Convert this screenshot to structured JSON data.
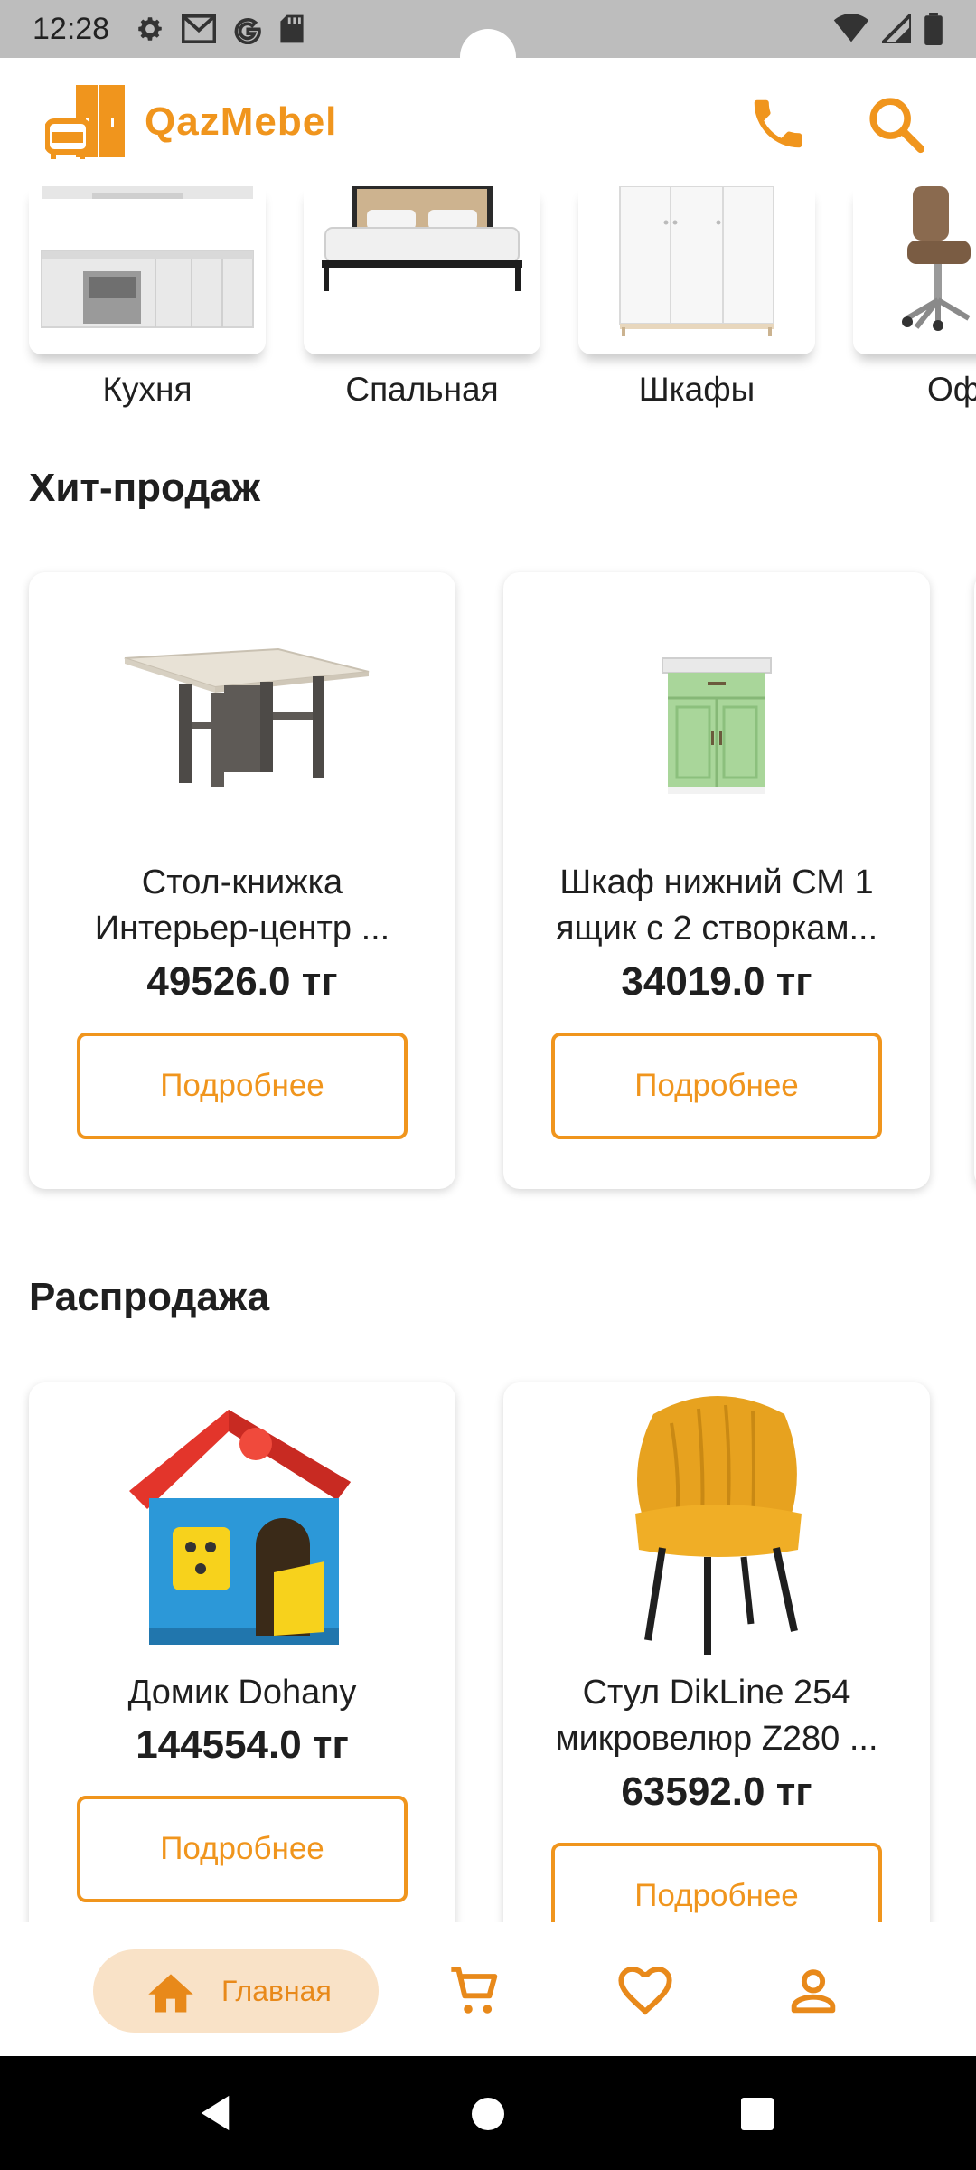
{
  "status_bar": {
    "time": "12:28"
  },
  "header": {
    "brand": "QazMebel"
  },
  "categories": [
    {
      "label": "Кухня"
    },
    {
      "label": "Спальная"
    },
    {
      "label": "Шкафы"
    },
    {
      "label": "Офисная"
    }
  ],
  "sections": {
    "hits": {
      "title": "Хит-продаж",
      "products": [
        {
          "name_line1": "Стол-книжка",
          "name_line2": "Интерьер-центр ...",
          "price": "49526.0 тг",
          "button": "Подробнее"
        },
        {
          "name_line1": "Шкаф нижний СМ 1",
          "name_line2": "ящик с 2 створкам...",
          "price": "34019.0 тг",
          "button": "Подробнее"
        }
      ]
    },
    "sale": {
      "title": "Распродажа",
      "products": [
        {
          "name_line1": "Домик Dohany",
          "price": "144554.0 тг",
          "button": "Подробнее"
        },
        {
          "name_line1": "Стул DikLine 254",
          "name_line2": "микровелюр Z280 ...",
          "price": "63592.0 тг",
          "button": "Подробнее"
        }
      ]
    }
  },
  "bottom_nav": {
    "home_label": "Главная"
  },
  "colors": {
    "accent": "#f0951d",
    "accent_light": "#f9e2c7"
  }
}
